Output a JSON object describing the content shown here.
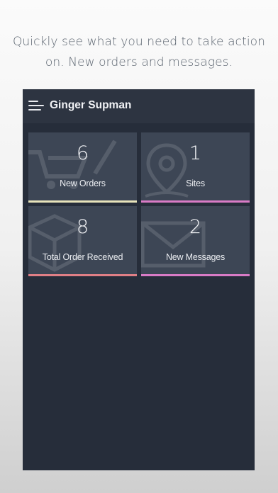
{
  "caption": {
    "line1": "Quickly see what you need to take action",
    "line2": "on. New orders and messages."
  },
  "header": {
    "title": "Ginger Supman",
    "menu_icon": "hamburger-menu-icon"
  },
  "tiles": [
    {
      "value": "6",
      "label": "New Orders",
      "icon": "shopping-cart-icon",
      "accent": "#e8e4bb"
    },
    {
      "value": "1",
      "label": "Sites",
      "icon": "map-pin-icon",
      "accent": "#d97bc6"
    },
    {
      "value": "8",
      "label": "Total Order Received",
      "icon": "package-box-icon",
      "accent": "#e07f86"
    },
    {
      "value": "2",
      "label": "New Messages",
      "icon": "envelope-icon",
      "accent": "#d97bc6"
    }
  ],
  "colors": {
    "app_background": "#262d3a",
    "header_background": "#2d3441",
    "tile_background": "#3d4655"
  }
}
